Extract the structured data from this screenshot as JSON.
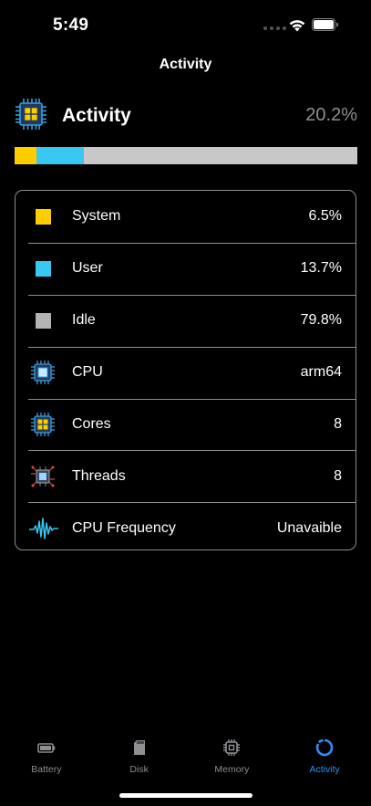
{
  "status_bar": {
    "time": "5:49"
  },
  "nav": {
    "title": "Activity"
  },
  "header": {
    "title": "Activity",
    "percent": "20.2%",
    "icon": "cpu-chip-icon"
  },
  "usage": {
    "segments": [
      {
        "name": "system",
        "fraction": 0.065,
        "color": "#ffcc00"
      },
      {
        "name": "user",
        "fraction": 0.137,
        "color": "#38c8f2"
      },
      {
        "name": "idle",
        "fraction": 0.798,
        "color": "#c8c8c8"
      }
    ]
  },
  "rows": [
    {
      "label": "System",
      "value": "6.5%",
      "icon": "yellow-swatch",
      "color": "#ffcc00"
    },
    {
      "label": "User",
      "value": "13.7%",
      "icon": "blue-swatch",
      "color": "#38c8f2"
    },
    {
      "label": "Idle",
      "value": "79.8%",
      "icon": "gray-swatch",
      "color": "#b4b4b4"
    },
    {
      "label": "CPU",
      "value": "arm64",
      "icon": "cpu-blue-icon"
    },
    {
      "label": "Cores",
      "value": "8",
      "icon": "cpu-chip-icon"
    },
    {
      "label": "Threads",
      "value": "8",
      "icon": "threads-chip-icon"
    },
    {
      "label": "CPU Frequency",
      "value": "Unavaible",
      "icon": "waveform-icon"
    }
  ],
  "tabs": [
    {
      "label": "Battery",
      "icon": "battery-icon",
      "active": false
    },
    {
      "label": "Disk",
      "icon": "sd-card-icon",
      "active": false
    },
    {
      "label": "Memory",
      "icon": "memory-chip-icon",
      "active": false
    },
    {
      "label": "Activity",
      "icon": "activity-ring-icon",
      "active": true
    }
  ],
  "colors": {
    "accent": "#2f8ff5",
    "inactive": "#8e8e93",
    "background": "#000000"
  }
}
